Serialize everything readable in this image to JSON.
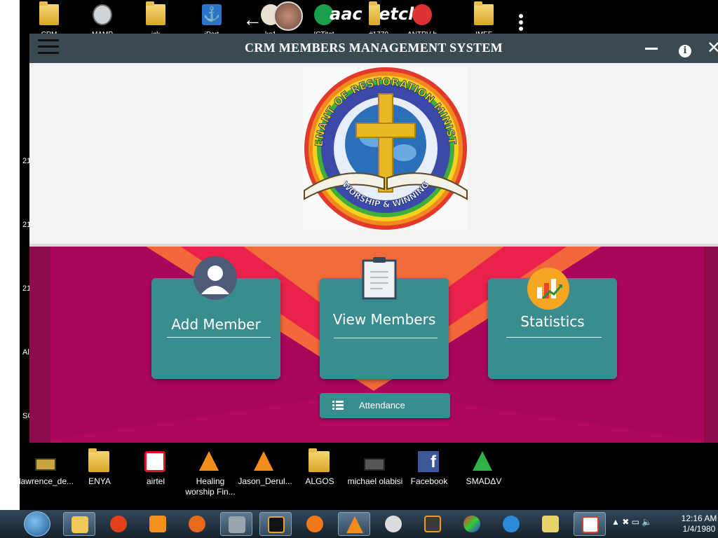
{
  "desktop_left_labels": [
    "21",
    "21",
    "21",
    "Al",
    "SC"
  ],
  "top_icons": [
    {
      "label": "CRM",
      "icon": "folder-icon"
    },
    {
      "label": "MAMP",
      "icon": "mamp-icon"
    },
    {
      "label": "ick",
      "icon": "folder-icon"
    },
    {
      "label": "iPort",
      "icon": "anchor-icon"
    },
    {
      "label": "ko1",
      "icon": "app-icon"
    },
    {
      "label": "ICTitat",
      "icon": "app-icon"
    },
    {
      "label": "#1770",
      "icon": "folder-icon"
    },
    {
      "label": "ANTRV-b",
      "icon": "shortcut-icon"
    },
    {
      "label": "IMEF",
      "icon": "folder-icon"
    }
  ],
  "top_text": "aac ketch",
  "window": {
    "title": "CRM MEMBERS MANAGEMENT SYSTEM",
    "menu_icon": "hamburger-icon",
    "minimize_icon": "minimize-icon",
    "info_icon": "info-icon",
    "info_glyph": "i",
    "close_icon": "close-icon",
    "close_glyph": "✕"
  },
  "logo": {
    "top_text": "COVENANT OF RESTORATION MINISTRIES",
    "bottom_text": "WORSHIP & WINNING",
    "colors": {
      "cross": "#e8b820",
      "globe": "#2a6fb8",
      "ring": "#3b4aa8"
    }
  },
  "cards": [
    {
      "label": "Add Member",
      "icon": "user-avatar-icon"
    },
    {
      "label": "View Members",
      "icon": "clipboard-icon"
    },
    {
      "label": "Statistics",
      "icon": "chart-icon"
    }
  ],
  "attendance": {
    "label": "Attendance",
    "icon": "list-icon"
  },
  "bottom_icons": [
    {
      "label": "lawrence_de...",
      "icon": "video-icon"
    },
    {
      "label": "ENYA",
      "icon": "folder-icon"
    },
    {
      "label": "airtel",
      "icon": "airtel-icon"
    },
    {
      "label": "Healing worship Fin...",
      "icon": "vlc-icon"
    },
    {
      "label": "Jason_Derul...",
      "icon": "vlc-icon"
    },
    {
      "label": "ALGOS",
      "icon": "folder-icon"
    },
    {
      "label": "michael olabisi",
      "icon": "video-icon"
    },
    {
      "label": "Facebook",
      "icon": "facebook-icon"
    },
    {
      "label": "SMADΔV",
      "icon": "smadav-icon"
    }
  ],
  "taskbar": {
    "time": "12:16 AM",
    "date": "1/4/1980",
    "apps": [
      "explorer",
      "chrome-like",
      "uc-browser",
      "firefox",
      "disk",
      "intellij",
      "avast",
      "vlc",
      "mamp",
      "sublime",
      "paint",
      "network",
      "file",
      "java"
    ]
  },
  "colors": {
    "title_bar": "#3a4a50",
    "card": "#3a8d8f",
    "banner_magenta": "#b0085f",
    "banner_orange": "#f2683a"
  }
}
